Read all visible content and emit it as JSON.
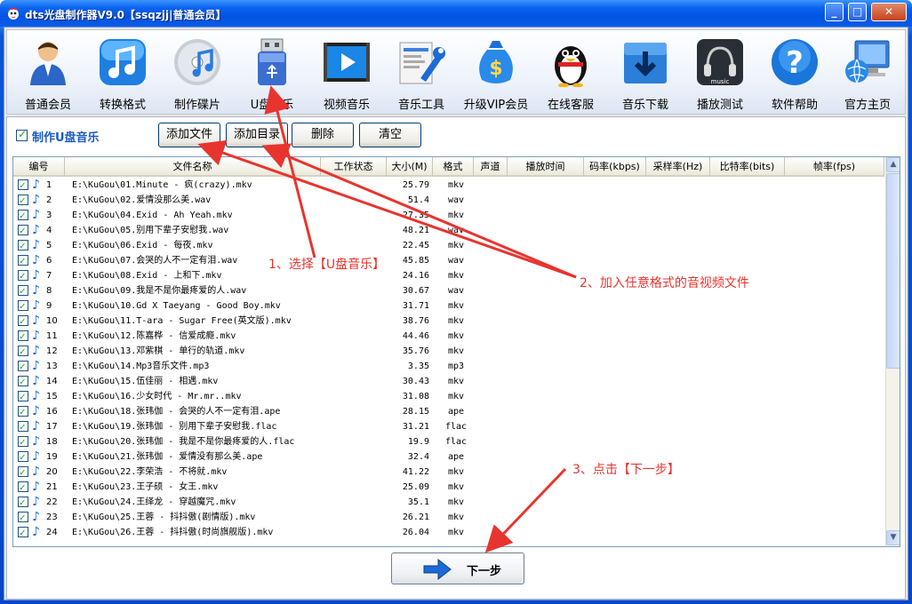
{
  "window": {
    "title": "dts光盘制作器V9.0【ssqzjj|普通会员】",
    "min": "_",
    "max": "□",
    "close": "✕"
  },
  "toolbar": [
    {
      "label": "普通会员",
      "icon": "user-icon"
    },
    {
      "label": "转换格式",
      "icon": "music-note-icon"
    },
    {
      "label": "制作碟片",
      "icon": "disc-icon"
    },
    {
      "label": "U盘音乐",
      "icon": "usb-drive-icon"
    },
    {
      "label": "视频音乐",
      "icon": "video-play-icon"
    },
    {
      "label": "音乐工具",
      "icon": "tools-icon"
    },
    {
      "label": "升级VIP会员",
      "icon": "money-bag-icon"
    },
    {
      "label": "在线客服",
      "icon": "penguin-icon"
    },
    {
      "label": "音乐下载",
      "icon": "download-icon"
    },
    {
      "label": "播放测试",
      "icon": "headphones-icon"
    },
    {
      "label": "软件帮助",
      "icon": "help-icon"
    },
    {
      "label": "官方主页",
      "icon": "globe-computer-icon"
    }
  ],
  "options": {
    "make_usb": "制作U盘音乐",
    "add_file": "添加文件",
    "add_dir": "添加目录",
    "delete": "删除",
    "clear": "清空"
  },
  "columns": [
    "编号",
    "文件名称",
    "工作状态",
    "大小(M)",
    "格式",
    "声道",
    "播放时间",
    "码率(kbps)",
    "采样率(Hz)",
    "比特率(bits)",
    "帧率(fps)"
  ],
  "rows": [
    {
      "num": "1",
      "name": "E:\\KuGou\\01.Minute - 疯(crazy).mkv",
      "size": "25.79",
      "fmt": "mkv"
    },
    {
      "num": "2",
      "name": "E:\\KuGou\\02.爱情没那么美.wav",
      "size": "51.4",
      "fmt": "wav"
    },
    {
      "num": "3",
      "name": "E:\\KuGou\\04.Exid - Ah Yeah.mkv",
      "size": "27.35",
      "fmt": "mkv"
    },
    {
      "num": "4",
      "name": "E:\\KuGou\\05.别用下辈子安慰我.wav",
      "size": "48.21",
      "fmt": "wav"
    },
    {
      "num": "5",
      "name": "E:\\KuGou\\06.Exid - 每夜.mkv",
      "size": "22.45",
      "fmt": "mkv"
    },
    {
      "num": "6",
      "name": "E:\\KuGou\\07.会哭的人不一定有泪.wav",
      "size": "45.85",
      "fmt": "wav"
    },
    {
      "num": "7",
      "name": "E:\\KuGou\\08.Exid - 上和下.mkv",
      "size": "24.16",
      "fmt": "mkv"
    },
    {
      "num": "8",
      "name": "E:\\KuGou\\09.我是不是你最疼爱的人.wav",
      "size": "30.67",
      "fmt": "wav"
    },
    {
      "num": "9",
      "name": "E:\\KuGou\\10.Gd X Taeyang - Good Boy.mkv",
      "size": "31.71",
      "fmt": "mkv"
    },
    {
      "num": "10",
      "name": "E:\\KuGou\\11.T-ara - Sugar Free(英文版).mkv",
      "size": "38.76",
      "fmt": "mkv"
    },
    {
      "num": "11",
      "name": "E:\\KuGou\\12.陈嘉桦 - 信爱成瘾.mkv",
      "size": "44.46",
      "fmt": "mkv"
    },
    {
      "num": "12",
      "name": "E:\\KuGou\\13.邓紫棋 - 单行的轨道.mkv",
      "size": "35.76",
      "fmt": "mkv"
    },
    {
      "num": "13",
      "name": "E:\\KuGou\\14.Mp3音乐文件.mp3",
      "size": "3.35",
      "fmt": "mp3"
    },
    {
      "num": "14",
      "name": "E:\\KuGou\\15.伍佳丽 - 相遇.mkv",
      "size": "30.43",
      "fmt": "mkv"
    },
    {
      "num": "15",
      "name": "E:\\KuGou\\16.少女时代 - Mr.mr..mkv",
      "size": "31.08",
      "fmt": "mkv"
    },
    {
      "num": "16",
      "name": "E:\\KuGou\\18.张玮伽 - 会哭的人不一定有泪.ape",
      "size": "28.15",
      "fmt": "ape"
    },
    {
      "num": "17",
      "name": "E:\\KuGou\\19.张玮伽 - 别用下辈子安慰我.flac",
      "size": "31.21",
      "fmt": "flac"
    },
    {
      "num": "18",
      "name": "E:\\KuGou\\20.张玮伽 - 我是不是你最疼爱的人.flac",
      "size": "19.9",
      "fmt": "flac"
    },
    {
      "num": "19",
      "name": "E:\\KuGou\\21.张玮伽 - 爱情没有那么美.ape",
      "size": "32.4",
      "fmt": "ape"
    },
    {
      "num": "20",
      "name": "E:\\KuGou\\22.李荣浩 - 不将就.mkv",
      "size": "41.22",
      "fmt": "mkv"
    },
    {
      "num": "21",
      "name": "E:\\KuGou\\23.王子硕 - 女王.mkv",
      "size": "25.09",
      "fmt": "mkv"
    },
    {
      "num": "22",
      "name": "E:\\KuGou\\24.王绎龙 - 穿越魔咒.mkv",
      "size": "35.1",
      "fmt": "mkv"
    },
    {
      "num": "23",
      "name": "E:\\KuGou\\25.王蓉 - 抖抖傲(剧情版).mkv",
      "size": "26.21",
      "fmt": "mkv"
    },
    {
      "num": "24",
      "name": "E:\\KuGou\\26.王蓉 - 抖抖傲(时尚旗舰版).mkv",
      "size": "26.04",
      "fmt": "mkv"
    }
  ],
  "next_button": "下一步",
  "annotations": {
    "step1": "1、选择【U盘音乐】",
    "step2": "2、加入任意格式的音视频文件",
    "step3": "3、点击【下一步】"
  },
  "colors": {
    "annotation": "#e8342e",
    "title_bar": "#0054e3",
    "link_blue": "#1a5cc0"
  }
}
